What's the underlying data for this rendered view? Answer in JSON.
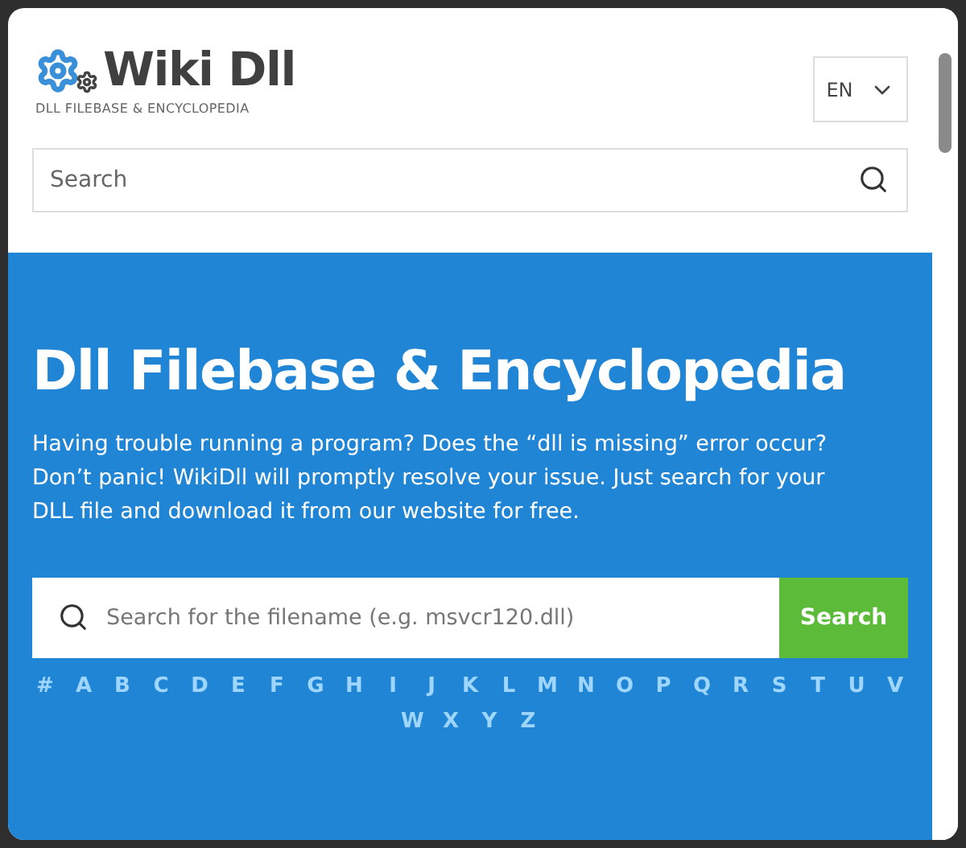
{
  "logo": {
    "name": "Wiki Dll",
    "tagline": "DLL FILEBASE & ENCYCLOPEDIA"
  },
  "language": {
    "value": "EN"
  },
  "search": {
    "placeholder": "Search"
  },
  "hero": {
    "title": "Dll Filebase & Encyclopedia",
    "text": "Having trouble running a program? Does the “dll is missing” error occur? Don’t panic! WikiDll will promptly resolve your issue. Just search for your DLL file and download it from our website for free.",
    "search": {
      "placeholder": "Search for the filename (e.g. msvcr120.dll)",
      "button": "Search"
    },
    "letters": [
      "#",
      "A",
      "B",
      "C",
      "D",
      "E",
      "F",
      "G",
      "H",
      "I",
      "J",
      "K",
      "L",
      "M",
      "N",
      "O",
      "P",
      "Q",
      "R",
      "S",
      "T",
      "U",
      "V",
      "W",
      "X",
      "Y",
      "Z"
    ]
  }
}
